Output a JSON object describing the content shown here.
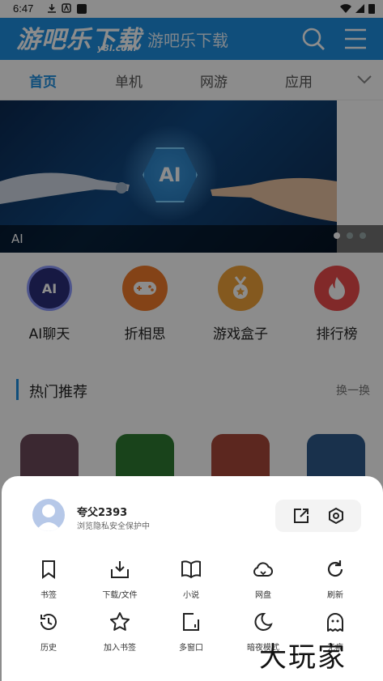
{
  "status_bar": {
    "time": "6:47"
  },
  "header": {
    "logo_text": "游吧乐下载",
    "logo_sub": "y8l.com",
    "title": "游吧乐下载"
  },
  "tabs": [
    {
      "label": "首页",
      "active": true
    },
    {
      "label": "单机",
      "active": false
    },
    {
      "label": "网游",
      "active": false
    },
    {
      "label": "应用",
      "active": false
    }
  ],
  "banner": {
    "caption": "AI",
    "chip_text": "AI",
    "dots": 3,
    "active_dot": 0
  },
  "quick_links": [
    {
      "label": "AI聊天",
      "icon": "ai-icon",
      "color": "#2a2f7a",
      "icon_text": "AI"
    },
    {
      "label": "折相思",
      "icon": "gamepad-icon",
      "color": "#f07a2a",
      "icon_text": ""
    },
    {
      "label": "游戏盒子",
      "icon": "medal-icon",
      "color": "#f0a23a",
      "icon_text": ""
    },
    {
      "label": "排行榜",
      "icon": "fire-icon",
      "color": "#ec4b4b",
      "icon_text": ""
    }
  ],
  "section": {
    "title": "热门推荐",
    "more": "换一换"
  },
  "apps": [
    {
      "color": "#6c4a5a"
    },
    {
      "color": "#2f7a32"
    },
    {
      "color": "#a8483a"
    },
    {
      "color": "#2f5a8a"
    }
  ],
  "sheet": {
    "user_name": "夸父2393",
    "user_sub": "浏览隐私安全保护中",
    "row1": [
      {
        "label": "书签",
        "icon": "bookmark-icon"
      },
      {
        "label": "下载/文件",
        "icon": "download-icon"
      },
      {
        "label": "小说",
        "icon": "book-icon"
      },
      {
        "label": "网盘",
        "icon": "cloud-icon"
      },
      {
        "label": "刷新",
        "icon": "refresh-icon"
      }
    ],
    "row2": [
      {
        "label": "历史",
        "icon": "history-icon"
      },
      {
        "label": "加入书签",
        "icon": "star-icon"
      },
      {
        "label": "多窗口",
        "icon": "window-icon"
      },
      {
        "label": "暗夜模式",
        "icon": "moon-icon"
      },
      {
        "label": "无痕",
        "icon": "ghost-icon"
      }
    ]
  },
  "watermark": "大玩家",
  "colors": {
    "brand": "#1e8fe0",
    "scrim": "rgba(0,0,0,0.45)",
    "sheet_bg": "#ffffff"
  }
}
